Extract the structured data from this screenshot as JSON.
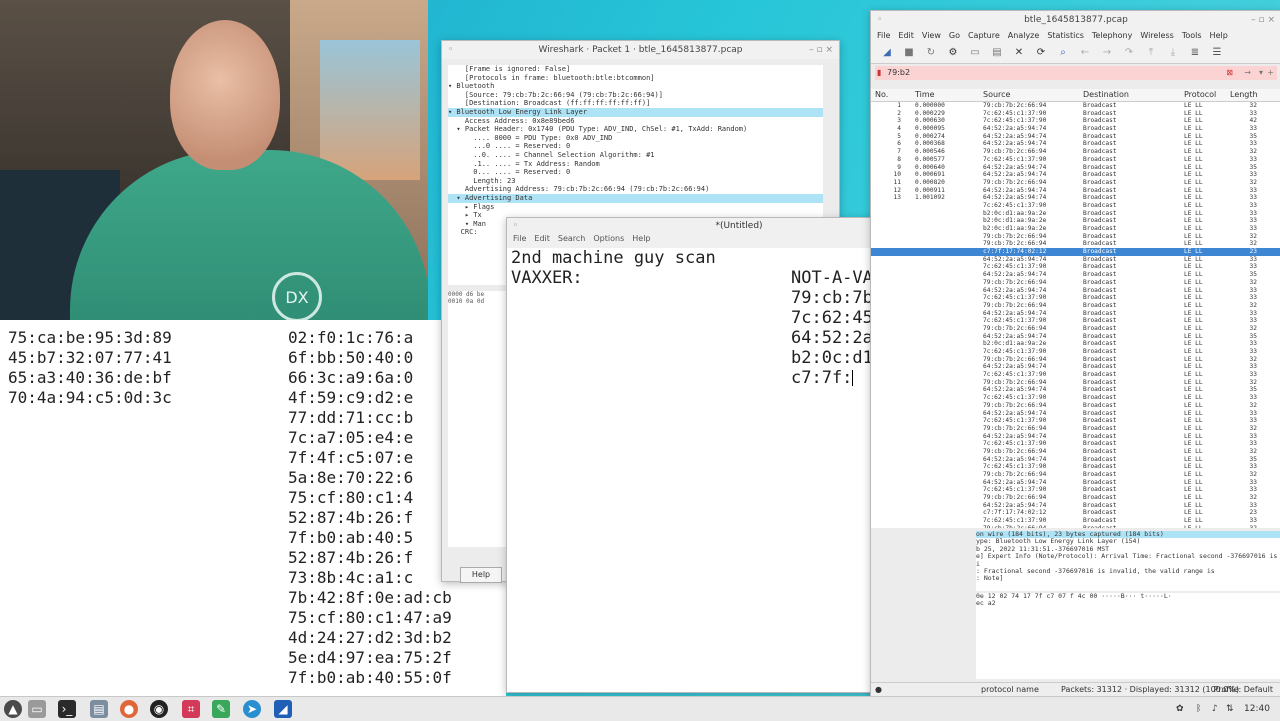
{
  "webcam": {
    "logo_text": "DX"
  },
  "left_text": {
    "col1": [
      "75:ca:be:95:3d:89",
      "45:b7:32:07:77:41",
      "65:a3:40:36:de:bf",
      "70:4a:94:c5:0d:3c"
    ],
    "col2": [
      "02:f0:1c:76:a",
      "6f:bb:50:40:0",
      "66:3c:a9:6a:0",
      "4f:59:c9:d2:e",
      "77:dd:71:cc:b",
      "7c:a7:05:e4:e",
      "7f:4f:c5:07:e",
      "5a:8e:70:22:6",
      "75:cf:80:c1:4",
      "52:87:4b:26:f",
      "7f:b0:ab:40:5",
      "52:87:4b:26:f",
      "73:8b:4c:a1:c",
      "7b:42:8f:0e:ad:cb",
      "75:cf:80:c1:47:a9",
      "4d:24:27:d2:3d:b2",
      "5e:d4:97:ea:75:2f",
      "7f:b0:ab:40:55:0f"
    ]
  },
  "packet_window": {
    "title": "Wireshark · Packet 1 · btle_1645813877.pcap",
    "tree": [
      {
        "text": "    [Frame is ignored: False]",
        "hl": false
      },
      {
        "text": "    [Protocols in frame: bluetooth:btle:btcommon]",
        "hl": false
      },
      {
        "text": "▾ Bluetooth",
        "hl": false
      },
      {
        "text": "    [Source: 79:cb:7b:2c:66:94 (79:cb:7b:2c:66:94)]",
        "hl": false
      },
      {
        "text": "    [Destination: Broadcast (ff:ff:ff:ff:ff:ff)]",
        "hl": false
      },
      {
        "text": "▾ Bluetooth Low Energy Link Layer",
        "hl": true
      },
      {
        "text": "    Access Address: 0x8e89bed6",
        "hl": false
      },
      {
        "text": "  ▾ Packet Header: 0x1740 (PDU Type: ADV_IND, ChSel: #1, TxAdd: Random)",
        "hl": false
      },
      {
        "text": "      .... 0000 = PDU Type: 0x0 ADV_IND",
        "hl": false
      },
      {
        "text": "      ...0 .... = Reserved: 0",
        "hl": false
      },
      {
        "text": "      ..0. .... = Channel Selection Algorithm: #1",
        "hl": false
      },
      {
        "text": "      .1.. .... = Tx Address: Random",
        "hl": false
      },
      {
        "text": "      0... .... = Reserved: 0",
        "hl": false
      },
      {
        "text": "      Length: 23",
        "hl": false
      },
      {
        "text": "    Advertising Address: 79:cb:7b:2c:66:94 (79:cb:7b:2c:66:94)",
        "hl": false
      },
      {
        "text": "  ▾ Advertising Data",
        "hl": true
      },
      {
        "text": "    ▸ Flags",
        "hl": false
      },
      {
        "text": "    ▸ Tx",
        "hl": false
      },
      {
        "text": "    ▾ Man",
        "hl": false
      },
      {
        "text": "",
        "hl": false
      },
      {
        "text": "   CRC:",
        "hl": false
      }
    ],
    "hex": [
      "0000  d6 be",
      "0010  0a 0d"
    ],
    "help_label": "Help"
  },
  "editor": {
    "title": "*(Untitled)",
    "menu": [
      "File",
      "Edit",
      "Search",
      "Options",
      "Help"
    ],
    "line1": "2nd machine guy scan",
    "vaxxer_label": "VAXXER:",
    "not_vaxxer_label": "NOT-A-VAXXER",
    "not_vaxxer_list": [
      "79:cb:7b:2c:66:9",
      "7c:62:45:c1:37:9",
      "64:52:2a:a5:94:7",
      "b2:0c:d1:aa:9a:2"
    ],
    "current_line": "c7:7f:"
  },
  "wireshark": {
    "title": "btle_1645813877.pcap",
    "menu": [
      "File",
      "Edit",
      "View",
      "Go",
      "Capture",
      "Analyze",
      "Statistics",
      "Telephony",
      "Wireless",
      "Tools",
      "Help"
    ],
    "filter": "79:b2",
    "columns": {
      "no": "No.",
      "time": "Time",
      "source": "Source",
      "destination": "Destination",
      "protocol": "Protocol",
      "length": "Length"
    },
    "rows": [
      {
        "no": "1",
        "time": "0.000000",
        "src": "79:cb:7b:2c:66:94",
        "dst": "Broadcast",
        "proto": "LE LL",
        "len": "32"
      },
      {
        "no": "2",
        "time": "0.000229",
        "src": "7c:62:45:c1:37:90",
        "dst": "Broadcast",
        "proto": "LE LL",
        "len": "33"
      },
      {
        "no": "3",
        "time": "0.000630",
        "src": "7c:62:45:c1:37:90",
        "dst": "Broadcast",
        "proto": "LE LL",
        "len": "42"
      },
      {
        "no": "4",
        "time": "0.000095",
        "src": "64:52:2a:a5:94:74",
        "dst": "Broadcast",
        "proto": "LE LL",
        "len": "33"
      },
      {
        "no": "5",
        "time": "0.000274",
        "src": "64:52:2a:a5:94:74",
        "dst": "Broadcast",
        "proto": "LE LL",
        "len": "35"
      },
      {
        "no": "6",
        "time": "0.000368",
        "src": "64:52:2a:a5:94:74",
        "dst": "Broadcast",
        "proto": "LE LL",
        "len": "33"
      },
      {
        "no": "7",
        "time": "0.000546",
        "src": "79:cb:7b:2c:66:94",
        "dst": "Broadcast",
        "proto": "LE LL",
        "len": "32"
      },
      {
        "no": "8",
        "time": "0.000577",
        "src": "7c:62:45:c1:37:90",
        "dst": "Broadcast",
        "proto": "LE LL",
        "len": "33"
      },
      {
        "no": "9",
        "time": "0.000640",
        "src": "64:52:2a:a5:94:74",
        "dst": "Broadcast",
        "proto": "LE LL",
        "len": "35"
      },
      {
        "no": "10",
        "time": "0.000691",
        "src": "64:52:2a:a5:94:74",
        "dst": "Broadcast",
        "proto": "LE LL",
        "len": "33"
      },
      {
        "no": "11",
        "time": "0.000820",
        "src": "79:cb:7b:2c:66:94",
        "dst": "Broadcast",
        "proto": "LE LL",
        "len": "32"
      },
      {
        "no": "12",
        "time": "0.000911",
        "src": "64:52:2a:a5:94:74",
        "dst": "Broadcast",
        "proto": "LE LL",
        "len": "33"
      },
      {
        "no": "13",
        "time": "1.001092",
        "src": "64:52:2a:a5:94:74",
        "dst": "Broadcast",
        "proto": "LE LL",
        "len": "33"
      },
      {
        "no": "",
        "time": "",
        "src": "7c:62:45:c1:37:90",
        "dst": "Broadcast",
        "proto": "LE LL",
        "len": "33"
      },
      {
        "no": "",
        "time": "",
        "src": "b2:0c:d1:aa:9a:2e",
        "dst": "Broadcast",
        "proto": "LE LL",
        "len": "33"
      },
      {
        "no": "",
        "time": "",
        "src": "b2:0c:d1:aa:9a:2e",
        "dst": "Broadcast",
        "proto": "LE LL",
        "len": "33"
      },
      {
        "no": "",
        "time": "",
        "src": "b2:0c:d1:aa:9a:2e",
        "dst": "Broadcast",
        "proto": "LE LL",
        "len": "33"
      },
      {
        "no": "",
        "time": "",
        "src": "79:cb:7b:2c:66:94",
        "dst": "Broadcast",
        "proto": "LE LL",
        "len": "32"
      },
      {
        "no": "",
        "time": "",
        "src": "79:cb:7b:2c:66:94",
        "dst": "Broadcast",
        "proto": "LE LL",
        "len": "32"
      },
      {
        "no": "",
        "time": "",
        "src": "c7:7f:17:74:02:12",
        "dst": "Broadcast",
        "proto": "LE LL",
        "len": "23",
        "sel": true
      },
      {
        "no": "",
        "time": "",
        "src": "64:52:2a:a5:94:74",
        "dst": "Broadcast",
        "proto": "LE LL",
        "len": "33"
      },
      {
        "no": "",
        "time": "",
        "src": "7c:62:45:c1:37:90",
        "dst": "Broadcast",
        "proto": "LE LL",
        "len": "33"
      },
      {
        "no": "",
        "time": "",
        "src": "64:52:2a:a5:94:74",
        "dst": "Broadcast",
        "proto": "LE LL",
        "len": "35"
      },
      {
        "no": "",
        "time": "",
        "src": "79:cb:7b:2c:66:94",
        "dst": "Broadcast",
        "proto": "LE LL",
        "len": "32"
      },
      {
        "no": "",
        "time": "",
        "src": "64:52:2a:a5:94:74",
        "dst": "Broadcast",
        "proto": "LE LL",
        "len": "33"
      },
      {
        "no": "",
        "time": "",
        "src": "7c:62:45:c1:37:90",
        "dst": "Broadcast",
        "proto": "LE LL",
        "len": "33"
      },
      {
        "no": "",
        "time": "",
        "src": "79:cb:7b:2c:66:94",
        "dst": "Broadcast",
        "proto": "LE LL",
        "len": "32"
      },
      {
        "no": "",
        "time": "",
        "src": "64:52:2a:a5:94:74",
        "dst": "Broadcast",
        "proto": "LE LL",
        "len": "33"
      },
      {
        "no": "",
        "time": "",
        "src": "7c:62:45:c1:37:90",
        "dst": "Broadcast",
        "proto": "LE LL",
        "len": "33"
      },
      {
        "no": "",
        "time": "",
        "src": "79:cb:7b:2c:66:94",
        "dst": "Broadcast",
        "proto": "LE LL",
        "len": "32"
      },
      {
        "no": "",
        "time": "",
        "src": "64:52:2a:a5:94:74",
        "dst": "Broadcast",
        "proto": "LE LL",
        "len": "35"
      },
      {
        "no": "",
        "time": "",
        "src": "b2:0c:d1:aa:9a:2e",
        "dst": "Broadcast",
        "proto": "LE LL",
        "len": "33"
      },
      {
        "no": "",
        "time": "",
        "src": "7c:62:45:c1:37:90",
        "dst": "Broadcast",
        "proto": "LE LL",
        "len": "33"
      },
      {
        "no": "",
        "time": "",
        "src": "79:cb:7b:2c:66:94",
        "dst": "Broadcast",
        "proto": "LE LL",
        "len": "32"
      },
      {
        "no": "",
        "time": "",
        "src": "64:52:2a:a5:94:74",
        "dst": "Broadcast",
        "proto": "LE LL",
        "len": "33"
      },
      {
        "no": "",
        "time": "",
        "src": "7c:62:45:c1:37:90",
        "dst": "Broadcast",
        "proto": "LE LL",
        "len": "33"
      },
      {
        "no": "",
        "time": "",
        "src": "79:cb:7b:2c:66:94",
        "dst": "Broadcast",
        "proto": "LE LL",
        "len": "32"
      },
      {
        "no": "",
        "time": "",
        "src": "64:52:2a:a5:94:74",
        "dst": "Broadcast",
        "proto": "LE LL",
        "len": "35"
      },
      {
        "no": "",
        "time": "",
        "src": "7c:62:45:c1:37:90",
        "dst": "Broadcast",
        "proto": "LE LL",
        "len": "33"
      },
      {
        "no": "",
        "time": "",
        "src": "79:cb:7b:2c:66:94",
        "dst": "Broadcast",
        "proto": "LE LL",
        "len": "32"
      },
      {
        "no": "",
        "time": "",
        "src": "64:52:2a:a5:94:74",
        "dst": "Broadcast",
        "proto": "LE LL",
        "len": "33"
      },
      {
        "no": "",
        "time": "",
        "src": "7c:62:45:c1:37:90",
        "dst": "Broadcast",
        "proto": "LE LL",
        "len": "33"
      },
      {
        "no": "",
        "time": "",
        "src": "79:cb:7b:2c:66:94",
        "dst": "Broadcast",
        "proto": "LE LL",
        "len": "32"
      },
      {
        "no": "",
        "time": "",
        "src": "64:52:2a:a5:94:74",
        "dst": "Broadcast",
        "proto": "LE LL",
        "len": "33"
      },
      {
        "no": "",
        "time": "",
        "src": "7c:62:45:c1:37:90",
        "dst": "Broadcast",
        "proto": "LE LL",
        "len": "33"
      },
      {
        "no": "",
        "time": "",
        "src": "79:cb:7b:2c:66:94",
        "dst": "Broadcast",
        "proto": "LE LL",
        "len": "32"
      },
      {
        "no": "",
        "time": "",
        "src": "64:52:2a:a5:94:74",
        "dst": "Broadcast",
        "proto": "LE LL",
        "len": "35"
      },
      {
        "no": "",
        "time": "",
        "src": "7c:62:45:c1:37:90",
        "dst": "Broadcast",
        "proto": "LE LL",
        "len": "33"
      },
      {
        "no": "",
        "time": "",
        "src": "79:cb:7b:2c:66:94",
        "dst": "Broadcast",
        "proto": "LE LL",
        "len": "32"
      },
      {
        "no": "",
        "time": "",
        "src": "64:52:2a:a5:94:74",
        "dst": "Broadcast",
        "proto": "LE LL",
        "len": "33"
      },
      {
        "no": "",
        "time": "",
        "src": "7c:62:45:c1:37:90",
        "dst": "Broadcast",
        "proto": "LE LL",
        "len": "33"
      },
      {
        "no": "",
        "time": "",
        "src": "79:cb:7b:2c:66:94",
        "dst": "Broadcast",
        "proto": "LE LL",
        "len": "32"
      },
      {
        "no": "",
        "time": "",
        "src": "64:52:2a:a5:94:74",
        "dst": "Broadcast",
        "proto": "LE LL",
        "len": "33"
      },
      {
        "no": "",
        "time": "",
        "src": "c7:7f:17:74:02:12",
        "dst": "Broadcast",
        "proto": "LE LL",
        "len": "23"
      },
      {
        "no": "",
        "time": "",
        "src": "7c:62:45:c1:37:90",
        "dst": "Broadcast",
        "proto": "LE LL",
        "len": "33"
      },
      {
        "no": "",
        "time": "",
        "src": "79:cb:7b:2c:66:94",
        "dst": "Broadcast",
        "proto": "LE LL",
        "len": "32"
      }
    ],
    "details": [
      {
        "text": "on wire (184 bits), 23 bytes captured (184 bits)",
        "hl": true
      },
      {
        "text": "ype: Bluetooth Low Energy Link Layer (154)",
        "hl": false
      },
      {
        "text": "b 25, 2022 11:31:51.-376697016 MST",
        "hl": false
      },
      {
        "text": "e] Expert Info (Note/Protocol): Arrival Time: Fractional second -376697016 is i",
        "hl": false
      },
      {
        "text": "  : Fractional second -376697016 is invalid, the valid range is",
        "hl": false
      },
      {
        "text": "  : Note]",
        "hl": false
      }
    ],
    "bytes": [
      "0e 12 02  74 17 7f c7 07 f 4c 00   ·····B···  t·····L·",
      "ec a2"
    ],
    "status": {
      "left": "protocol name",
      "packets": "Packets: 31312 · Displayed: 31312 (100.0%)",
      "profile": "Profile: Default"
    }
  },
  "taskbar": {
    "clock": "12:40"
  }
}
